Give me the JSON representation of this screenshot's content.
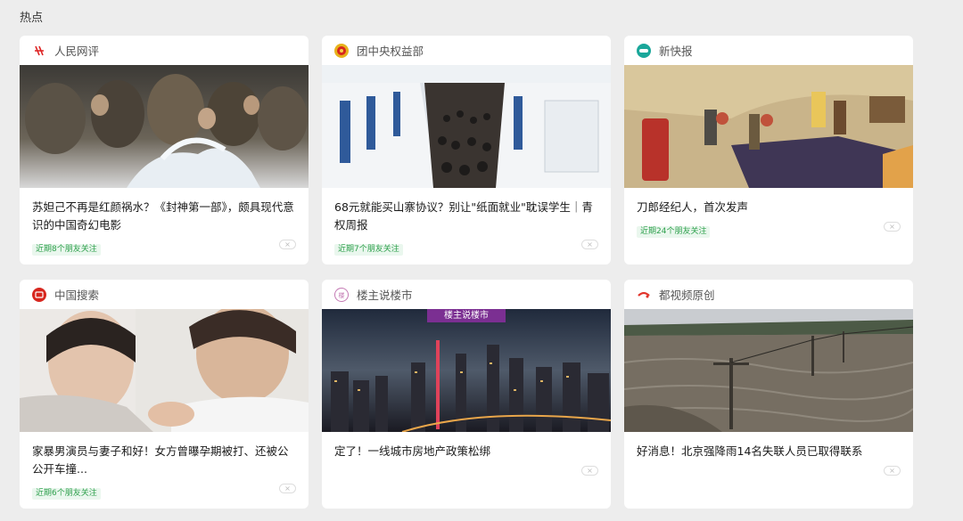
{
  "section_title": "热点",
  "cards": [
    {
      "source": "人民网评",
      "title": "苏妲己不再是红颜祸水？《封神第一部》，颇具现代意识的中国奇幻电影",
      "friends": "近期8个朋友关注"
    },
    {
      "source": "团中央权益部",
      "title": "68元就能买山寨协议？别让\"纸面就业\"耽误学生｜青权周报",
      "friends": "近期7个朋友关注"
    },
    {
      "source": "新快报",
      "title": "刀郎经纪人，首次发声",
      "friends": "近期24个朋友关注"
    },
    {
      "source": "中国搜索",
      "title": "家暴男演员与妻子和好！女方曾曝孕期被打、还被公公开车撞...",
      "friends": "近期6个朋友关注"
    },
    {
      "source": "楼主说楼市",
      "title": "定了！一线城市房地产政策松绑",
      "friends": "",
      "image_banner": "楼主说楼市"
    },
    {
      "source": "都视频原创",
      "title": "好消息！北京强降雨14名失联人员已取得联系",
      "friends": ""
    }
  ],
  "icons": [
    "people-daily-logo-icon",
    "youth-league-logo-icon",
    "xinkuaibao-logo-icon",
    "china-search-logo-icon",
    "loushi-logo-icon",
    "du-video-logo-icon",
    "close-icon"
  ],
  "colors": {
    "background": "#ededed",
    "card": "#ffffff",
    "friend_badge_text": "#30a14e",
    "friend_badge_bg": "#eaf7ee"
  }
}
